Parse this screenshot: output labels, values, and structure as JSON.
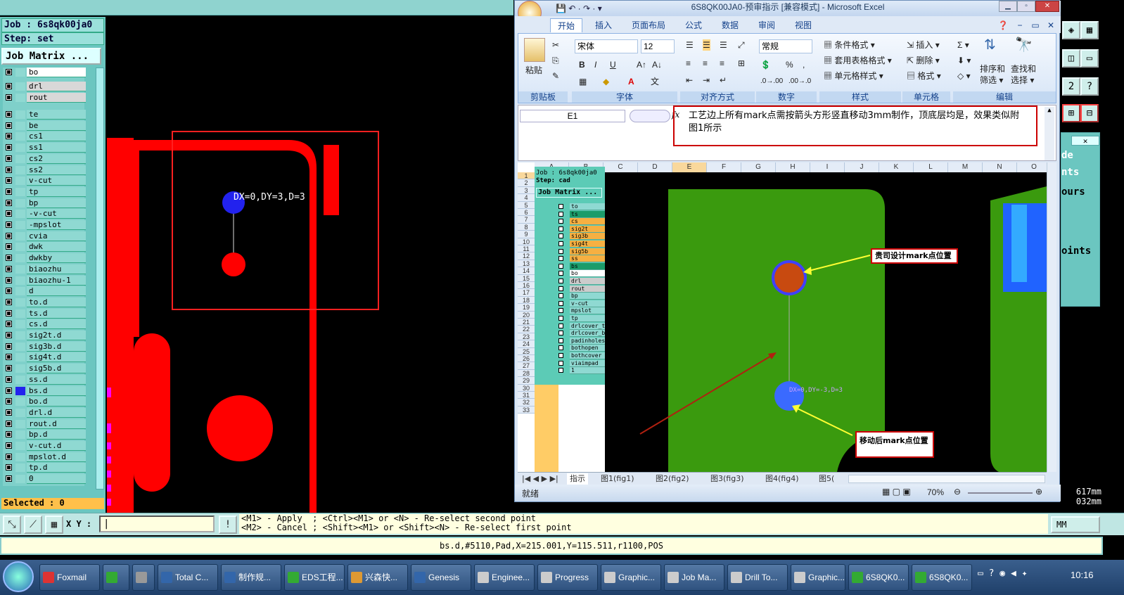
{
  "genesis": {
    "job_label": "Job : 6s8qk00ja0",
    "step_label": "Step: set",
    "job_matrix_button": "Job Matrix ...",
    "layers": [
      "bo",
      "drl",
      "rout",
      "te",
      "be",
      "cs1",
      "ss1",
      "cs2",
      "ss2",
      "v-cut",
      "tp",
      "bp",
      "-v-cut",
      "-mpslot",
      "cvia",
      "dwk",
      "dwkby",
      "biaozhu",
      "biaozhu-1",
      "d",
      "to.d",
      "ts.d",
      "cs.d",
      "sig2t.d",
      "sig3b.d",
      "sig4t.d",
      "sig5b.d",
      "ss.d",
      "bs.d",
      "bo.d",
      "drl.d",
      "rout.d",
      "bp.d",
      "v-cut.d",
      "mpslot.d",
      "tp.d",
      "0"
    ],
    "selected_text": "Selected : 0",
    "measure_label": "DX=0,DY=3,D=3",
    "xy_label": "X Y :",
    "help_line_1": "<M1> - Apply  ; <Ctrl><M1> or <N> - Re-select second point",
    "help_line_2": "<M2> - Cancel ; <Shift><M1> or <Shift><N> - Re-select first point",
    "status_line": "bs.d,#5110,Pad,X=215.001,Y=115.511,r1100,POS",
    "units_label": "MM",
    "right_panel": [
      "de",
      "nts",
      "ours",
      "oints"
    ],
    "coord_1": "617mm",
    "coord_2": "032mm",
    "pencil_icon": "✐"
  },
  "excel": {
    "title": "6S8QK00JA0-预审指示 [兼容模式] - Microsoft Excel",
    "tabs": [
      "开始",
      "插入",
      "页面布局",
      "公式",
      "数据",
      "审阅",
      "视图"
    ],
    "paste_label": "粘贴",
    "font_name": "宋体",
    "font_size": "12",
    "number_format": "常规",
    "group_labels": [
      "剪贴板",
      "字体",
      "对齐方式",
      "数字",
      "样式",
      "单元格",
      "编辑"
    ],
    "style_items": [
      "条件格式",
      "套用表格格式",
      "单元格样式"
    ],
    "cell_items": [
      "插入",
      "删除",
      "格式"
    ],
    "edit_items": [
      "排序和",
      "筛选",
      "查找和",
      "选择"
    ],
    "name_box": "E1",
    "formula_text": "工艺边上所有mark点需按箭头方形竖直移动3mm制作，顶底层均是，效果类似附图1所示",
    "columns": [
      "A",
      "B",
      "C",
      "D",
      "E",
      "F",
      "G",
      "H",
      "I",
      "J",
      "K",
      "L",
      "M",
      "N",
      "O"
    ],
    "rows": [
      "1",
      "2",
      "3",
      "4",
      "5",
      "6",
      "7",
      "8",
      "9",
      "10",
      "11",
      "12",
      "13",
      "14",
      "15",
      "16",
      "17",
      "18",
      "19",
      "20",
      "21",
      "22",
      "23",
      "24",
      "25",
      "26",
      "27",
      "28",
      "29",
      "30",
      "31",
      "32",
      "33"
    ],
    "mini_job": "Job : 6s8qk00ja0",
    "mini_step": "Step: cad",
    "mini_matrix": "Job Matrix ...",
    "mini_layers": [
      "to",
      "ts",
      "cs",
      "sig2t",
      "sig3b",
      "sig4t",
      "sig5b",
      "ss",
      "bs",
      "bo",
      "drl",
      "rout",
      "bp",
      "v-cut",
      "mpslot",
      "tp",
      "drlcover_t",
      "drlcover_b",
      "padinholes",
      "bothopen",
      "bothcover",
      "viaimpad",
      "1"
    ],
    "callout_1": "贵司设计mark点位置",
    "callout_2": "移动后mark点位置",
    "mini_measure": "DX=0,DY=-3,D=3",
    "sheet_tabs": [
      "指示",
      "图1(fig1)",
      "图2(fig2)",
      "图3(fig3)",
      "图4(fig4)",
      "图5("
    ],
    "status_ready": "就绪",
    "zoom": "70%"
  },
  "taskbar": {
    "items": [
      "Foxmail",
      "",
      "",
      "Total C...",
      "制作规...",
      "EDS工程...",
      "兴森快...",
      "Genesis",
      "Enginee...",
      "Progress",
      "Graphic...",
      "Job Ma...",
      "Drill To...",
      "Graphic...",
      "6S8QK0...",
      "6S8QK0..."
    ],
    "clock": "10:16"
  },
  "colors": {
    "accent_red": "#ff0000",
    "pad_blue": "#2222ee",
    "genesis_cyan": "#6bc6c0",
    "excel_blue": "#dbe7f5",
    "callout_border": "#cc0000"
  }
}
